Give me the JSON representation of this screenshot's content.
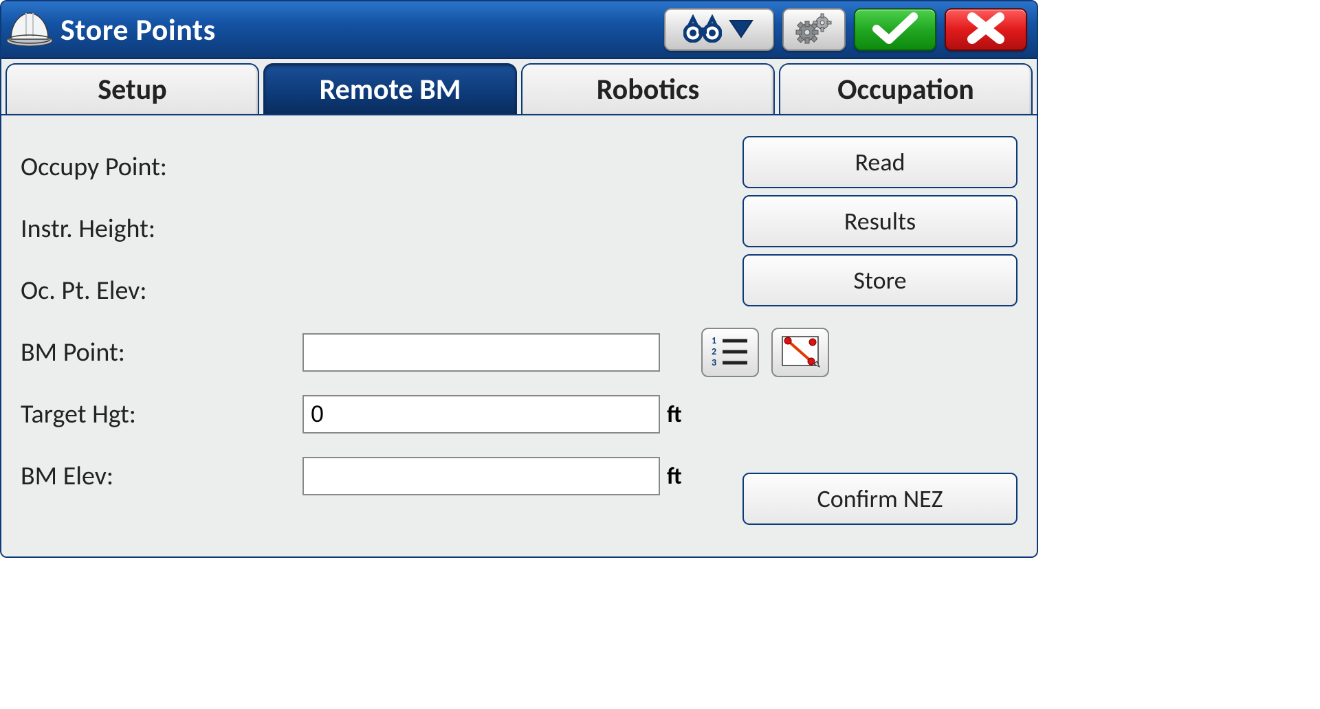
{
  "title": "Store Points",
  "tabs": [
    {
      "label": "Setup",
      "active": false
    },
    {
      "label": "Remote BM",
      "active": true
    },
    {
      "label": "Robotics",
      "active": false
    },
    {
      "label": "Occupation",
      "active": false
    }
  ],
  "labels": {
    "occupy_point": "Occupy Point:",
    "instr_height": "Instr. Height:",
    "oc_pt_elev": "Oc. Pt. Elev:",
    "bm_point": "BM Point:",
    "target_hgt": "Target Hgt:",
    "bm_elev": "BM Elev:"
  },
  "fields": {
    "bm_point": "",
    "target_hgt": "0",
    "bm_elev": "",
    "target_hgt_unit": "ft",
    "bm_elev_unit": "ft"
  },
  "buttons": {
    "read": "Read",
    "results": "Results",
    "store": "Store",
    "confirm_nez": "Confirm NEZ"
  },
  "icons": {
    "helmet": "hardhat-icon",
    "binoculars": "binoculars-icon",
    "dropdown": "triangle-down-icon",
    "gears": "gears-icon",
    "check": "check-icon",
    "close": "close-x-icon",
    "list": "numbered-list-icon",
    "map_points": "map-points-icon"
  }
}
